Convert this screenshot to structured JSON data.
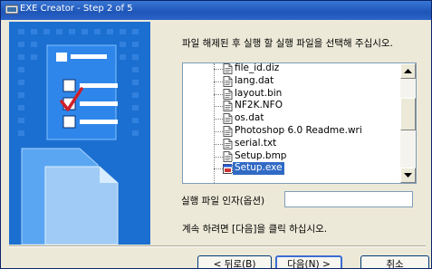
{
  "window": {
    "title": "EXE Creator - Step 2 of 5"
  },
  "main": {
    "instruction": "파일 해제된 후 실행 할 실행 파일을 선택해 주십시오.",
    "files": [
      {
        "name": "file_id.diz",
        "icon": "text-file-icon"
      },
      {
        "name": "lang.dat",
        "icon": "text-file-icon"
      },
      {
        "name": "layout.bin",
        "icon": "text-file-icon"
      },
      {
        "name": "NF2K.NFO",
        "icon": "text-file-icon"
      },
      {
        "name": "os.dat",
        "icon": "text-file-icon"
      },
      {
        "name": "Photoshop 6.0 Readme.wri",
        "icon": "text-file-icon"
      },
      {
        "name": "serial.txt",
        "icon": "text-file-icon"
      },
      {
        "name": "Setup.bmp",
        "icon": "text-file-icon"
      },
      {
        "name": "Setup.exe",
        "icon": "exe-file-icon",
        "selected": true
      }
    ],
    "argument_label": "실행 파일 인자(옵션)",
    "argument_value": "",
    "hint": "계속 하려면 [다음]을 클릭 하십시오."
  },
  "buttons": {
    "back": "< 뒤로(B)",
    "next": "다음(N) >",
    "cancel": "취소"
  },
  "colors": {
    "side_panel": "#1b6fd0",
    "selection": "#316ac5",
    "checkmark": "#d0202a"
  }
}
